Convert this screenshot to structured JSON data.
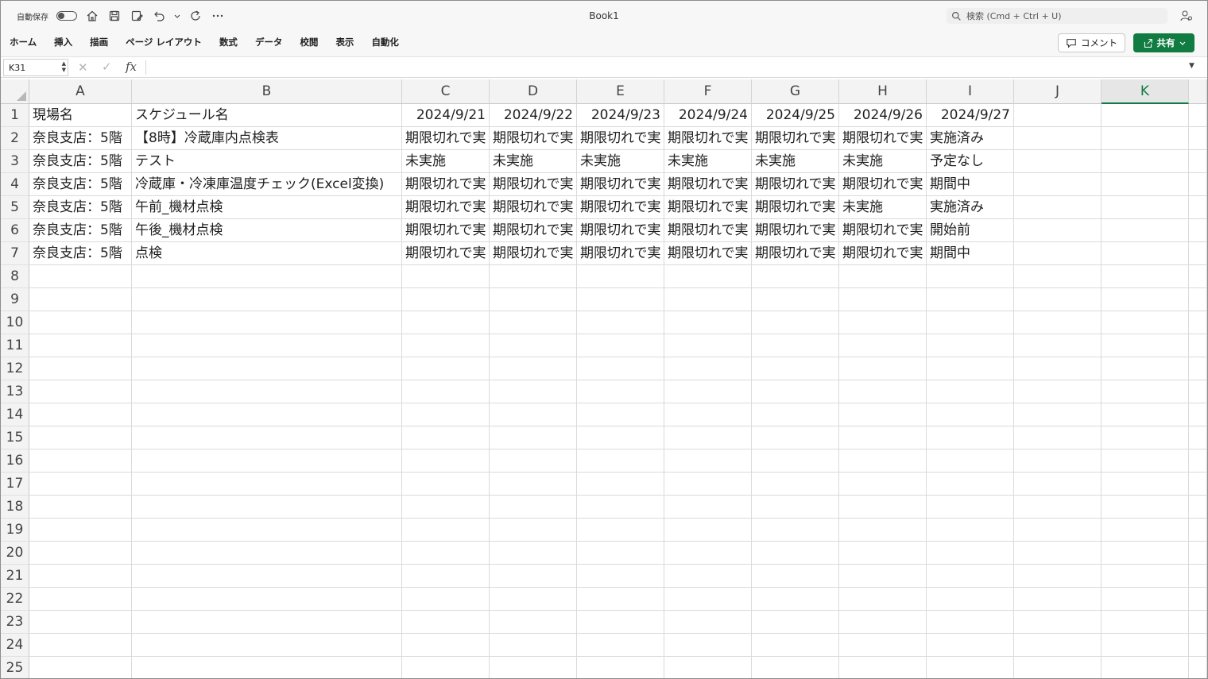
{
  "titlebar": {
    "autosave_label": "自動保存",
    "book_title": "Book1",
    "search_placeholder": "検索 (Cmd + Ctrl + U)"
  },
  "ribbon": {
    "tabs": [
      "ホーム",
      "挿入",
      "描画",
      "ページ レイアウト",
      "数式",
      "データ",
      "校閲",
      "表示",
      "自動化"
    ],
    "comment_label": "コメント",
    "share_label": "共有"
  },
  "formula_bar": {
    "name_box": "K31",
    "fx_label": "fx",
    "formula": ""
  },
  "sheet": {
    "columns": [
      "A",
      "B",
      "C",
      "D",
      "E",
      "F",
      "G",
      "H",
      "I",
      "J",
      "K"
    ],
    "selected_column": "K",
    "row_numbers": [
      "1",
      "2",
      "3",
      "4",
      "5",
      "6",
      "7",
      "8",
      "9",
      "10",
      "11",
      "12",
      "13",
      "14",
      "15",
      "16",
      "17",
      "18",
      "19",
      "20",
      "21",
      "22",
      "23",
      "24",
      "25"
    ],
    "rows": [
      [
        "現場名",
        "スケジュール名",
        "2024/9/21",
        "2024/9/22",
        "2024/9/23",
        "2024/9/24",
        "2024/9/25",
        "2024/9/26",
        "2024/9/27",
        "",
        ""
      ],
      [
        "奈良支店：5階",
        "【8時】冷蔵庫内点検表",
        "期限切れで実",
        "期限切れで実",
        "期限切れで実",
        "期限切れで実",
        "期限切れで実",
        "期限切れで実",
        "実施済み",
        "",
        ""
      ],
      [
        "奈良支店：5階",
        "テスト",
        "未実施",
        "未実施",
        "未実施",
        "未実施",
        "未実施",
        "未実施",
        "予定なし",
        "",
        ""
      ],
      [
        "奈良支店：5階",
        "冷蔵庫・冷凍庫温度チェック(Excel変換)",
        "期限切れで実",
        "期限切れで実",
        "期限切れで実",
        "期限切れで実",
        "期限切れで実",
        "期限切れで実",
        "期間中",
        "",
        ""
      ],
      [
        "奈良支店：5階",
        "午前_機材点検",
        "期限切れで実",
        "期限切れで実",
        "期限切れで実",
        "期限切れで実",
        "期限切れで実",
        "未実施",
        "実施済み",
        "",
        ""
      ],
      [
        "奈良支店：5階",
        "午後_機材点検",
        "期限切れで実",
        "期限切れで実",
        "期限切れで実",
        "期限切れで実",
        "期限切れで実",
        "期限切れで実",
        "開始前",
        "",
        ""
      ],
      [
        "奈良支店：5階",
        "点検",
        "期限切れで実",
        "期限切れで実",
        "期限切れで実",
        "期限切れで実",
        "期限切れで実",
        "期限切れで実",
        "期間中",
        "",
        ""
      ]
    ]
  },
  "colors": {
    "accent": "#107c41",
    "chrome_bg": "#f7f7f7",
    "header_bg": "#f3f3f3"
  },
  "icons": [
    "toggle-icon",
    "home-icon",
    "save-icon",
    "save-as-icon",
    "undo-icon",
    "redo-icon",
    "more-icon",
    "search-icon",
    "user-settings-icon",
    "comment-icon",
    "share-icon",
    "chevron-down-icon"
  ]
}
